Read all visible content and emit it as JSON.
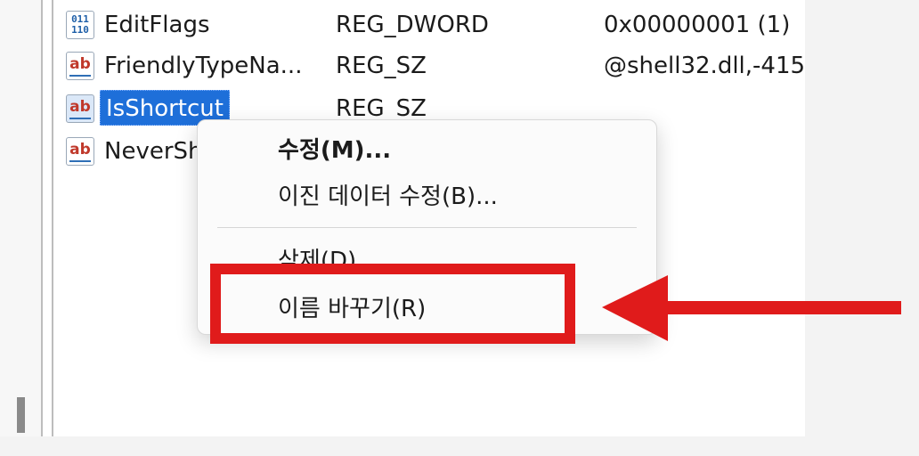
{
  "registry_rows": [
    {
      "icon": "binary-value-icon",
      "name": "EditFlags",
      "type": "REG_DWORD",
      "data": "0x00000001 (1)"
    },
    {
      "icon": "string-value-icon",
      "name": "FriendlyTypeNa...",
      "type": "REG_SZ",
      "data": "@shell32.dll,-415"
    },
    {
      "icon": "string-value-icon",
      "name": "IsShortcut",
      "type": "REG_SZ",
      "data": ""
    },
    {
      "icon": "string-value-icon",
      "name": "NeverSh",
      "type": "",
      "data": ""
    }
  ],
  "icons": {
    "binary_glyph_top": "011",
    "binary_glyph_bottom": "110",
    "string_glyph": "ab"
  },
  "context_menu": {
    "modify": "수정(M)...",
    "modify_binary": "이진 데이터 수정(B)...",
    "delete": "삭제(D)",
    "rename": "이름 바꾸기(R)"
  },
  "colors": {
    "selection": "#1e6fd9",
    "annotation_red": "#e01b1b"
  }
}
